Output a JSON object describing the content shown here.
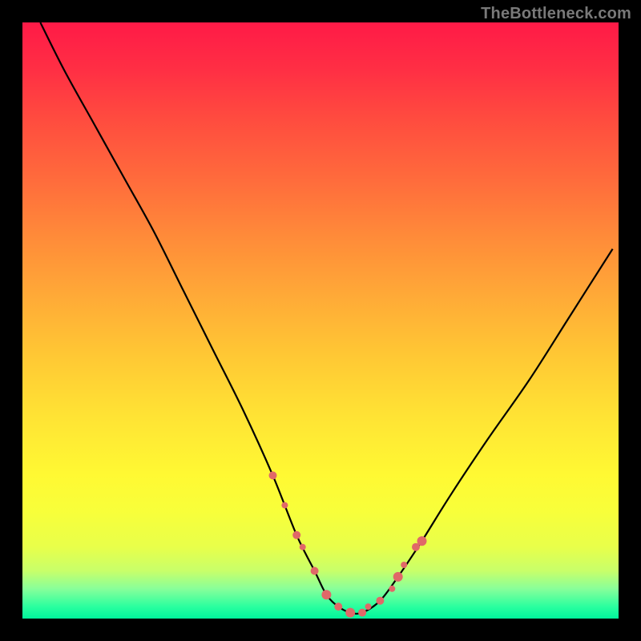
{
  "watermark": "TheBottleneck.com",
  "colors": {
    "curve_stroke": "#000000",
    "marker_fill": "#e06868",
    "marker_stroke": "#c05454",
    "bg_top": "#ff1a47",
    "bg_bottom": "#00f59c",
    "frame": "#000000"
  },
  "chart_data": {
    "type": "line",
    "title": "",
    "xlabel": "",
    "ylabel": "",
    "xlim": [
      0,
      100
    ],
    "ylim": [
      0,
      100
    ],
    "grid": false,
    "series": [
      {
        "name": "bottleneck-curve",
        "x": [
          3,
          7,
          12,
          17,
          22,
          27,
          32,
          37,
          42,
          46,
          49,
          51,
          53,
          55,
          57,
          60,
          63,
          67,
          72,
          78,
          85,
          92,
          99
        ],
        "values": [
          100,
          92,
          83,
          74,
          65,
          55,
          45,
          35,
          24,
          14,
          8,
          4,
          2,
          1,
          1,
          3,
          7,
          13,
          21,
          30,
          40,
          51,
          62
        ]
      }
    ],
    "markers": {
      "name": "highlighted-points",
      "x": [
        42,
        44,
        46,
        47,
        49,
        51,
        53,
        55,
        57,
        58,
        60,
        62,
        63,
        64,
        66,
        67
      ],
      "values": [
        24,
        19,
        14,
        12,
        8,
        4,
        2,
        1,
        1,
        2,
        3,
        5,
        7,
        9,
        12,
        13
      ],
      "radius": [
        5,
        4,
        5,
        4,
        5,
        6,
        5,
        6,
        5,
        4,
        5,
        4,
        6,
        4,
        5,
        6
      ]
    }
  }
}
